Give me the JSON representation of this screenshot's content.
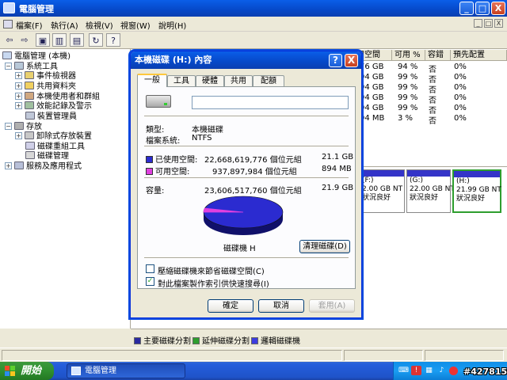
{
  "window": {
    "title": "電腦管理",
    "btn_min": "_",
    "btn_max": "□",
    "btn_close": "X"
  },
  "menu": {
    "items": [
      "檔案(F)",
      "執行(A)",
      "檢視(V)",
      "視窗(W)",
      "說明(H)"
    ],
    "mdi_min": "_",
    "mdi_restore": "□",
    "mdi_close": "X"
  },
  "toolbar": {
    "back": "⇦",
    "forward": "⇨",
    "up": "▣",
    "tree": "▥",
    "props": "▤",
    "refresh": "↻",
    "help": "?"
  },
  "tree": {
    "items": [
      {
        "label": "電腦管理 (本機)",
        "expander": ""
      },
      {
        "label": "系統工具",
        "expander": "−"
      },
      {
        "label": "事件檢視器",
        "expander": "+"
      },
      {
        "label": "共用資料夾",
        "expander": "+"
      },
      {
        "label": "本機使用者和群組",
        "expander": "+"
      },
      {
        "label": "效能記錄及警示",
        "expander": "+"
      },
      {
        "label": "裝置管理員",
        "expander": ""
      },
      {
        "label": "存放",
        "expander": "−"
      },
      {
        "label": "卸除式存放裝置",
        "expander": "+"
      },
      {
        "label": "磁碟重組工具",
        "expander": ""
      },
      {
        "label": "磁碟管理",
        "expander": ""
      },
      {
        "label": "服務及應用程式",
        "expander": "+"
      }
    ]
  },
  "list": {
    "headers": [
      "用空間",
      "可用 %",
      "容錯",
      "預先配置"
    ],
    "rows": [
      [
        "76 GB",
        "94 %",
        "否",
        "0%"
      ],
      [
        "94 GB",
        "99 %",
        "否",
        "0%"
      ],
      [
        "94 GB",
        "99 %",
        "否",
        "0%"
      ],
      [
        "94 GB",
        "99 %",
        "否",
        "0%"
      ],
      [
        "94 GB",
        "99 %",
        "否",
        "0%"
      ],
      [
        "94 MB",
        "3 %",
        "否",
        "0%"
      ]
    ]
  },
  "partitions": [
    {
      "drive": "(F:)",
      "size": "2.00 GB NT",
      "status": "狀況良好"
    },
    {
      "drive": "(G:)",
      "size": "22.00 GB NT",
      "status": "狀況良好"
    },
    {
      "drive": "(H:)",
      "size": "21.99 GB NT",
      "status": "狀況良好"
    }
  ],
  "legend": {
    "primary": "主要磁碟分割",
    "extended": "延伸磁碟分割",
    "logical": "邏輯磁碟機",
    "primary_color": "#2a2aa0",
    "extended_color": "#2e9e2e",
    "logical_color": "#3c3ce0"
  },
  "taskbar": {
    "start": "開始",
    "task": "電腦管理",
    "watermark": "#427815"
  },
  "dialog": {
    "title": "本機磁碟 (H:) 內容",
    "help": "?",
    "close": "X",
    "tabs": [
      "一般",
      "工具",
      "硬體",
      "共用",
      "配額"
    ],
    "name_value": "",
    "type_label": "類型:",
    "type_value": "本機磁碟",
    "fs_label": "檔案系統:",
    "fs_value": "NTFS",
    "used_label": "已使用空間:",
    "used_bytes": "22,668,619,776 個位元組",
    "used_size": "21.1 GB",
    "free_label": "可用空間:",
    "free_bytes": "937,897,984 個位元組",
    "free_size": "894 MB",
    "capacity_label": "容量:",
    "capacity_bytes": "23,606,517,760 個位元組",
    "capacity_size": "21.9 GB",
    "disk_label": "磁碟機 H",
    "cleanup": "清理磁碟(D)",
    "compress": "壓縮磁碟機來節省磁碟空間(C)",
    "index": "對此檔案製作索引供快速搜尋(I)",
    "index_checked": "✓",
    "ok": "確定",
    "cancel": "取消",
    "apply": "套用(A)",
    "used_color": "#2b2bd0",
    "free_color": "#e040e0",
    "used_fraction": 0.96
  }
}
